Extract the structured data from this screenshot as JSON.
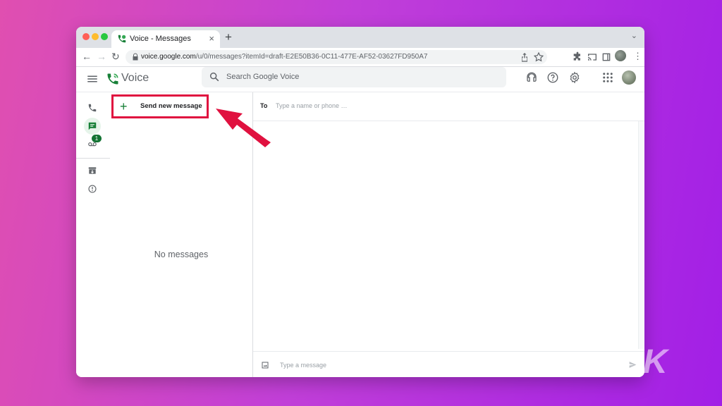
{
  "browser": {
    "tab_title": "Voice - Messages",
    "tab_close": "×",
    "new_tab": "+",
    "tab_menu": "⌄",
    "url_host": "voice.google.com",
    "url_path": "/u/0/messages?itemId=draft-E2E50B36-0C11-477E-AF52-03627FD950A7",
    "back": "←",
    "forward": "→",
    "reload": "↻",
    "menu": "⋮"
  },
  "app": {
    "name": "Voice",
    "search_placeholder": "Search Google Voice",
    "brand_color": "#188038"
  },
  "rail": {
    "voicemail_badge": "1"
  },
  "list": {
    "send_new_label": "Send new message",
    "send_new_plus": "+",
    "empty_text": "No messages"
  },
  "conversation": {
    "to_label": "To",
    "to_placeholder": "Type a name or phone …",
    "compose_placeholder": "Type a message"
  },
  "annotation": {
    "highlight_color": "#e0113f"
  },
  "watermark": "K",
  "icons": [
    "hamburger-icon",
    "voice-logo-icon",
    "search-icon",
    "headset-icon",
    "help-icon",
    "settings-icon",
    "apps-grid-icon",
    "phone-icon",
    "message-icon",
    "voicemail-icon",
    "archive-icon",
    "info-icon",
    "image-icon",
    "send-icon"
  ]
}
